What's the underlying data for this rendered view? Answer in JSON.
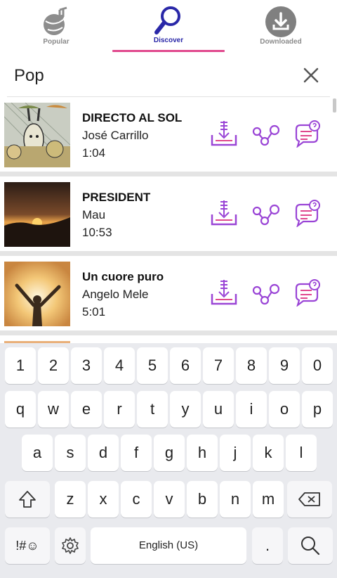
{
  "tabs": [
    {
      "label": "Popular",
      "icon": "music-note-globe-icon"
    },
    {
      "label": "Discover",
      "icon": "search-icon"
    },
    {
      "label": "Downloaded",
      "icon": "download-icon"
    }
  ],
  "active_tab": "Discover",
  "colors": {
    "accent": "#2a28a8",
    "underline": "#e0488d",
    "action_icon": "#9a45d6"
  },
  "search": {
    "value": "Pop",
    "clear_icon": "close-icon"
  },
  "songs": [
    {
      "title": "DIRECTO AL SOL",
      "artist": "José Carrillo",
      "duration": "1:04"
    },
    {
      "title": "PRESIDENT",
      "artist": "Mau",
      "duration": "10:53"
    },
    {
      "title": "Un cuore puro",
      "artist": "Angelo Mele",
      "duration": "5:01"
    }
  ],
  "song_actions": [
    "download-icon",
    "share-icon",
    "comment-question-icon"
  ],
  "keyboard": {
    "row_numbers": [
      "1",
      "2",
      "3",
      "4",
      "5",
      "6",
      "7",
      "8",
      "9",
      "0"
    ],
    "row_1": [
      "q",
      "w",
      "e",
      "r",
      "t",
      "y",
      "u",
      "i",
      "o",
      "p"
    ],
    "row_2": [
      "a",
      "s",
      "d",
      "f",
      "g",
      "h",
      "j",
      "k",
      "l"
    ],
    "row_3": [
      "z",
      "x",
      "c",
      "v",
      "b",
      "n",
      "m"
    ],
    "symbols_key": "!#☺",
    "space_label": "English (US)",
    "period": "."
  }
}
